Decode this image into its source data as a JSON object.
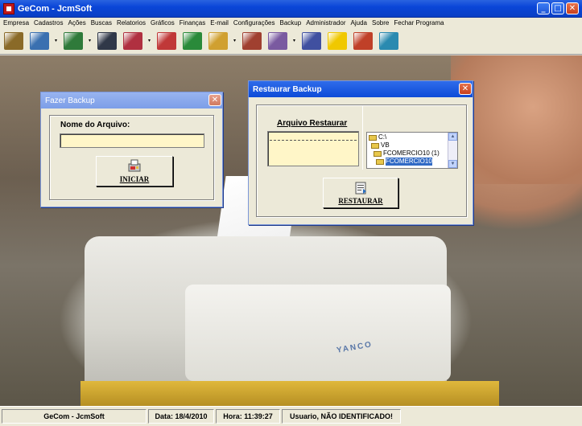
{
  "window": {
    "title": "GeCom - JcmSoft",
    "buttons": [
      "_",
      "□",
      "✕"
    ]
  },
  "menu": [
    "Empresa",
    "Cadastros",
    "Ações",
    "Buscas",
    "Relatorios",
    "Gráficos",
    "Finanças",
    "E-mail",
    "Configurações",
    "Backup",
    "Administrador",
    "Ajuda",
    "Sobre",
    "Fechar Programa"
  ],
  "toolbar": {
    "buttons": [
      {
        "name": "briefcase-icon",
        "color": "#8a6a28"
      },
      {
        "name": "handshake-icon",
        "color": "#3a70b0"
      },
      {
        "name": "calculator-icon",
        "color": "#2f7a3a"
      },
      {
        "name": "binoculars-icon",
        "color": "#303848"
      },
      {
        "name": "cart-icon",
        "color": "#b03040"
      },
      {
        "name": "chart-icon",
        "color": "#c03838"
      },
      {
        "name": "money-icon",
        "color": "#2a8a3a"
      },
      {
        "name": "key-icon",
        "color": "#d0a030"
      },
      {
        "name": "tools-icon",
        "color": "#a04030"
      },
      {
        "name": "backup-icon",
        "color": "#7a5aa0"
      },
      {
        "name": "admin-user-icon",
        "color": "#4050a0"
      },
      {
        "name": "help-icon",
        "color": "#f0c800"
      },
      {
        "name": "calendar-icon",
        "color": "#c04028"
      },
      {
        "name": "exit-door-icon",
        "color": "#2a8ab0"
      }
    ]
  },
  "dialog_backup": {
    "title": "Fazer Backup",
    "close": "✕",
    "filename_label": "Nome do Arquivo:",
    "filename_value": "",
    "start_button": "INICIAR"
  },
  "dialog_restore": {
    "title": "Restaurar Backup",
    "close": "✕",
    "restore_file_label": "Arquivo Restaurar",
    "folders": [
      {
        "label": "C:\\",
        "selected": false,
        "indent": 0
      },
      {
        "label": "VB",
        "selected": false,
        "indent": 1
      },
      {
        "label": "FCOMERCIO10 (1)",
        "selected": false,
        "indent": 2
      },
      {
        "label": "FCOMERCIO10",
        "selected": true,
        "indent": 3
      }
    ],
    "restore_button": "RESTAURAR"
  },
  "desktop": {
    "brand_text": "YANCO"
  },
  "status": {
    "app": "GeCom - JcmSoft",
    "date": "Data: 18/4/2010",
    "time": "Hora: 11:39:27",
    "user": "Usuario, NÃO IDENTIFICADO!"
  }
}
